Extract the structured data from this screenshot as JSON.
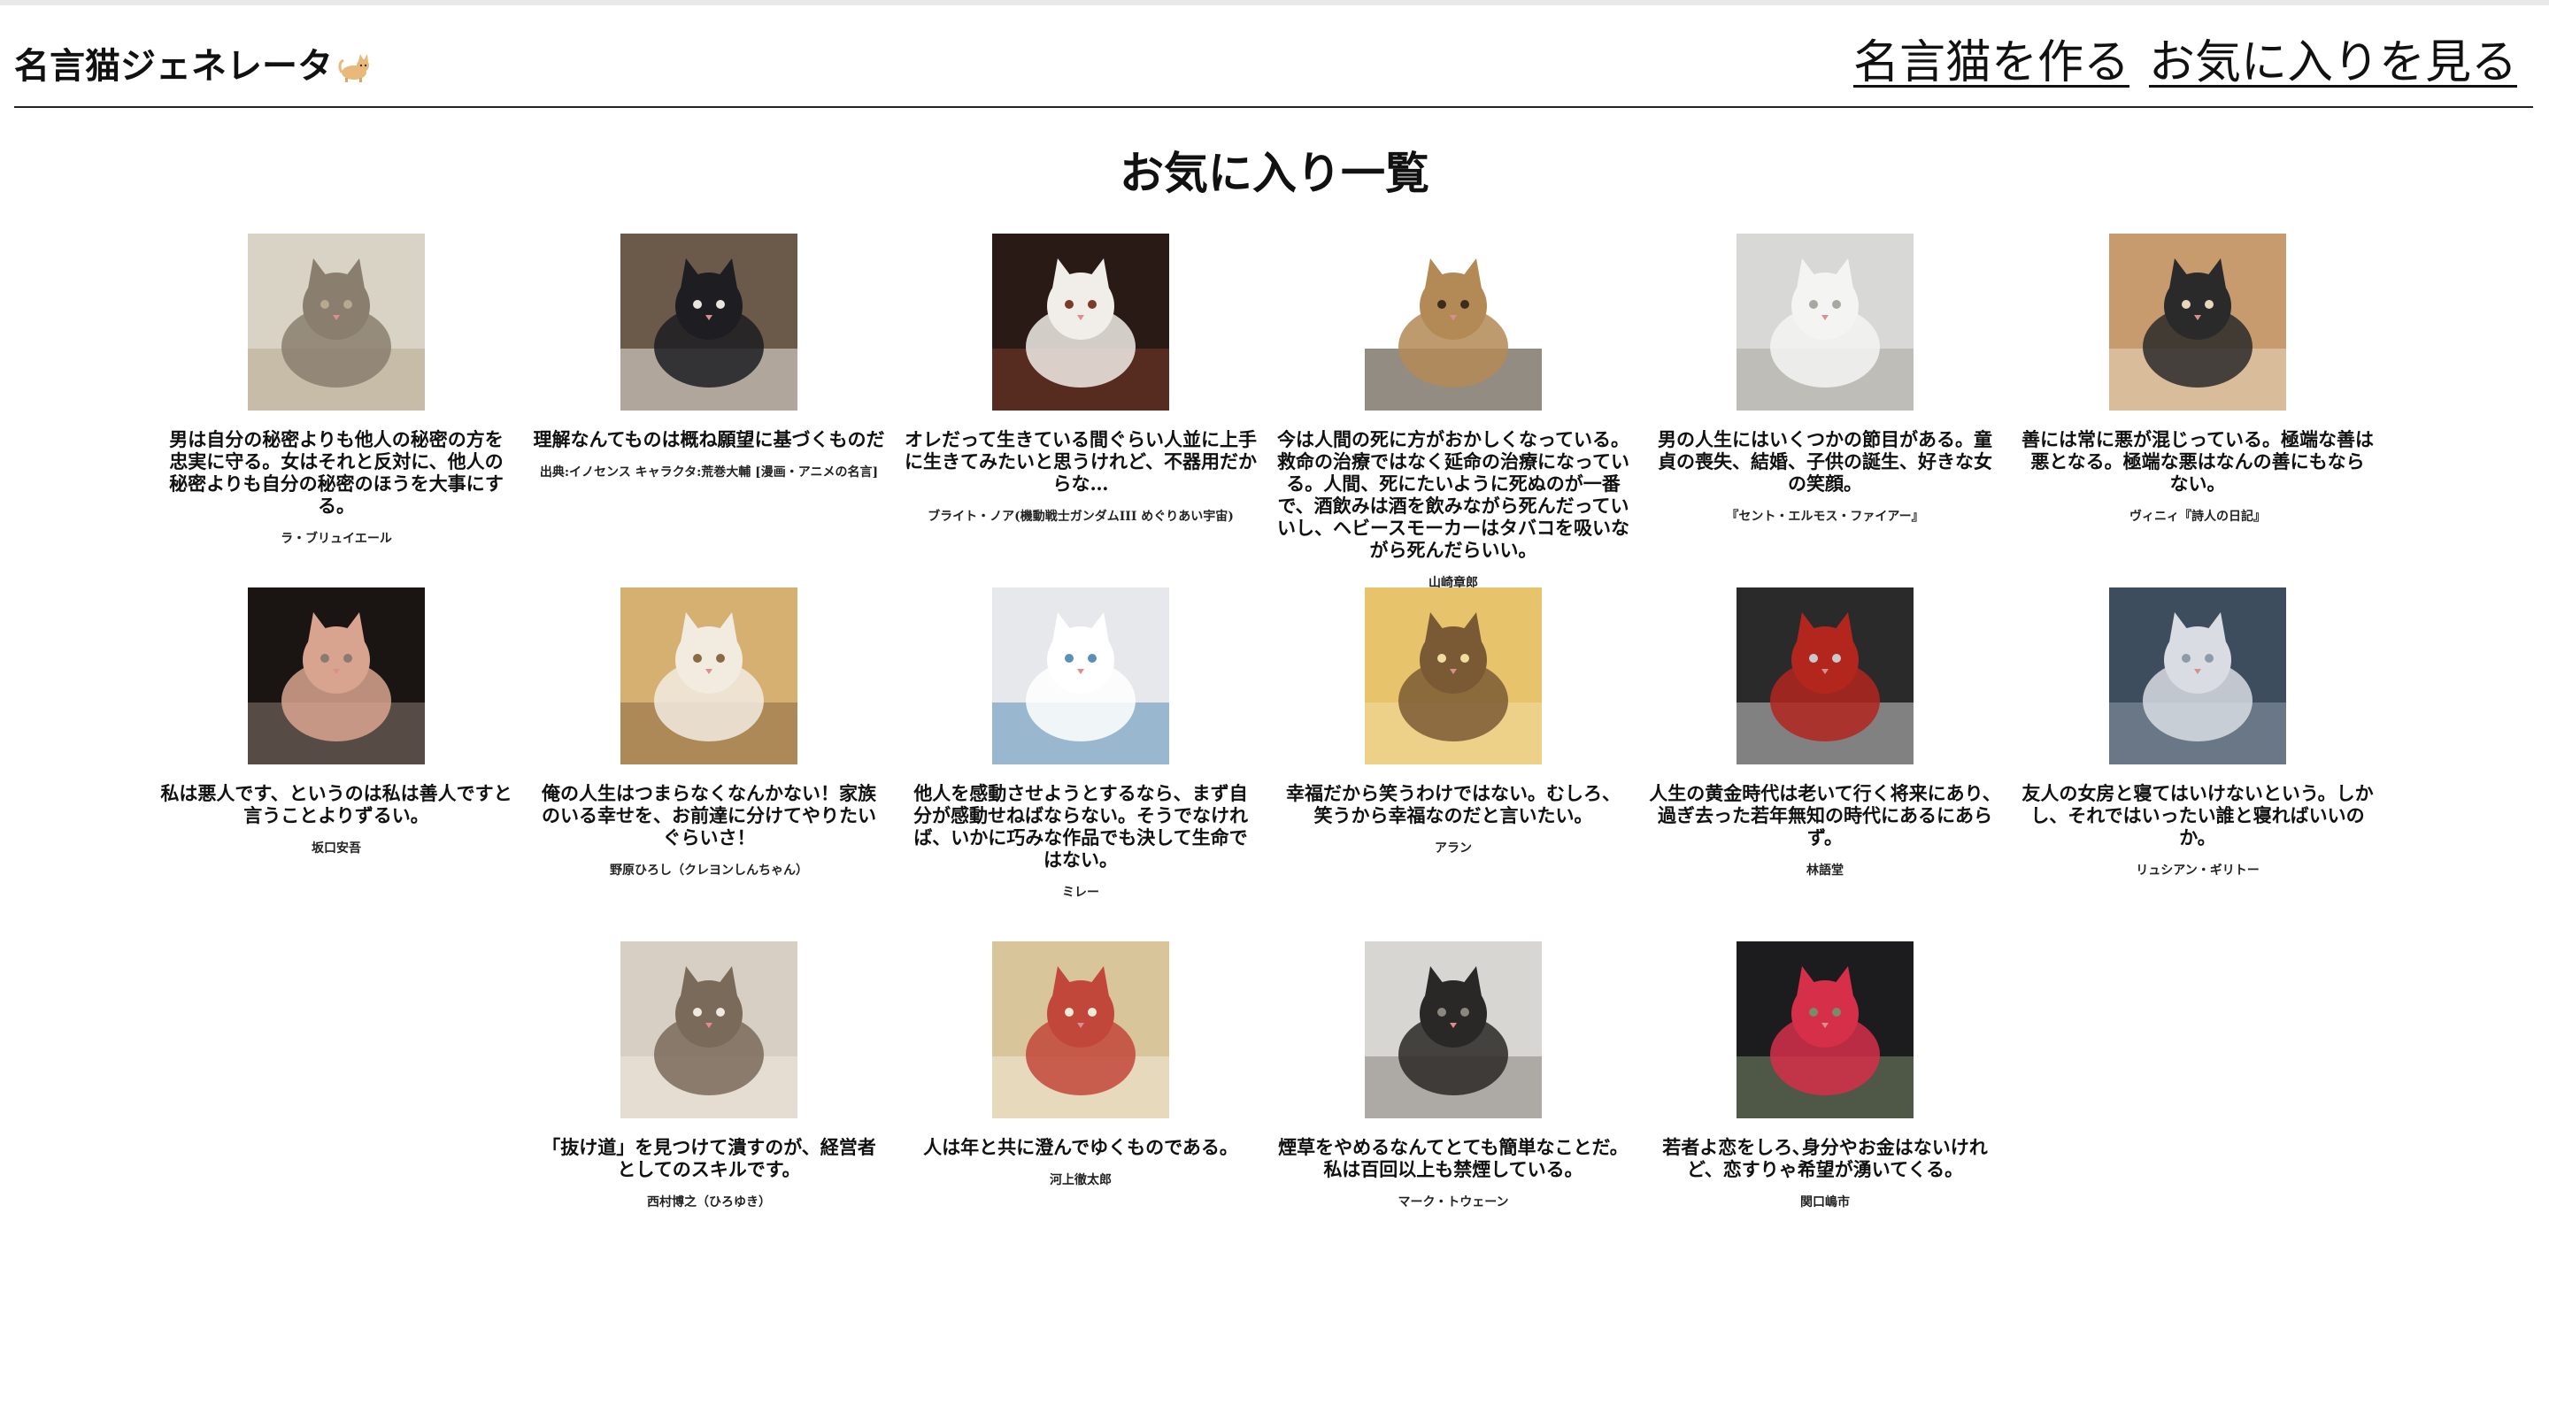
{
  "app": {
    "title": "名言猫ジェネレータ",
    "emoji_icon": "cat-emoji-icon"
  },
  "nav": {
    "create_label": "名言猫を作る",
    "favorites_label": "お気に入りを見る"
  },
  "page_title": "お気に入り一覧",
  "cards": [
    {
      "quote": "男は自分の秘密よりも他人の秘密の方を忠実に守る。女はそれと反対に、他人の秘密よりも自分の秘密のほうを大事にする。",
      "source": "ラ・ブリュイエール",
      "image": "kitten-crying",
      "colors": [
        "#d9d3c6",
        "#8a7f6e",
        "#b7a98f"
      ]
    },
    {
      "quote": "理解なんてものは概ね願望に基づくものだ",
      "source": "出典:イノセンス キャラクタ:荒巻大輔 [漫画・アニメの名言]",
      "image": "black-white-cat-stretching",
      "colors": [
        "#6b5a4a",
        "#1d1d22",
        "#e9e6e0"
      ]
    },
    {
      "quote": "オレだって生きている間ぐらい人並に上手に生きてみたいと思うけれど、不器用だからな…",
      "source": "ブライト・ノア(機動戦士ガンダムIII めぐりあい宇宙)",
      "image": "cat-on-back",
      "colors": [
        "#2a1a15",
        "#f1ede8",
        "#7a3b2a"
      ]
    },
    {
      "quote": "今は人間の死に方がおかしくなっている。救命の治療ではなく延命の治療になっている。人間、死にたいように死ぬのが一番で、酒飲みは酒を飲みながら死んだっていいし、ヘビースモーカーはタバコを吸いながら死んだらいい。",
      "source": "山崎章郎",
      "image": "bengal-cat",
      "colors": [
        "#ffffff",
        "#b38a56",
        "#3b2d1e"
      ]
    },
    {
      "quote": "男の人生にはいくつかの節目がある。童貞の喪失、結婚、子供の誕生、好きな女の笑顔。",
      "source": "『セント・エルモス・ファイアー』",
      "image": "white-cat-sleeping",
      "colors": [
        "#d8d8d6",
        "#f4f4f2",
        "#a9a7a1"
      ]
    },
    {
      "quote": "善には常に悪が混じっている。極端な善は悪となる。極端な悪はなんの善にもならない。",
      "source": "ヴィニィ『詩人の日記』",
      "image": "orange-cat-in-bed",
      "colors": [
        "#c79b6e",
        "#2a2a2a",
        "#e8d7bd"
      ]
    },
    {
      "quote": "私は悪人です、というのは私は善人ですと言うことよりずるい。",
      "source": "坂口安吾",
      "image": "kitten-in-hand",
      "colors": [
        "#1a1412",
        "#d9a48f",
        "#8b7a70"
      ]
    },
    {
      "quote": "俺の人生はつまらなくなんかない！家族のいる幸せを、お前達に分けてやりたいぐらいさ！",
      "source": "野原ひろし（クレヨンしんちゃん）",
      "image": "cat-face-closeup",
      "colors": [
        "#d6b071",
        "#f2ebe0",
        "#8a6a40"
      ]
    },
    {
      "quote": "他人を感動させようとするなら、まず自分が感動せねばならない。そうでなければ、いかに巧みな作品でも決して生命ではない。",
      "source": "ミレー",
      "image": "two-white-kittens",
      "colors": [
        "#e7e8ec",
        "#ffffff",
        "#5a8fb8"
      ]
    },
    {
      "quote": "幸福だから笑うわけではない。むしろ、笑うから幸福なのだと言いたい。",
      "source": "アラン",
      "image": "cat-on-yellow-floor",
      "colors": [
        "#e7c36b",
        "#7a5a34",
        "#f3dca0"
      ]
    },
    {
      "quote": "人生の黄金時代は老いて行く将来にあり、過ぎ去った若年無知の時代にあるにあらず。",
      "source": "林語堂",
      "image": "cat-in-red-sweater",
      "colors": [
        "#2a2a2a",
        "#b3261e",
        "#c9c9c9"
      ]
    },
    {
      "quote": "友人の女房と寝てはいけないという。しかし、それではいったい誰と寝ればいいのか。",
      "source": "リュシアン・ギリトー",
      "image": "fluffy-cat-by-window",
      "colors": [
        "#3d4d5e",
        "#d9dde3",
        "#8e9aa8"
      ]
    },
    {
      "quote": "「抜け道」を見つけて潰すのが、経営者としてのスキルです。",
      "source": "西村博之（ひろゆき）",
      "image": "tabby-kitten-held",
      "colors": [
        "#d8cfc4",
        "#7a6a5a",
        "#f1e8df"
      ]
    },
    {
      "quote": "人は年と共に澄んでゆくものである。",
      "source": "河上徹太郎",
      "image": "cat-in-bonnet",
      "colors": [
        "#d9c59a",
        "#c2473b",
        "#f3ead8"
      ]
    },
    {
      "quote": "煙草をやめるなんてとても簡単なことだ。私は百回以上も禁煙している。",
      "source": "マーク・トウェーン",
      "image": "kittens-playing-bw",
      "colors": [
        "#d8d6d2",
        "#2a2826",
        "#8a8680"
      ]
    },
    {
      "quote": "若者よ恋をしろ､身分やお金はないけれど、恋すりゃ希望が湧いてくる。",
      "source": "関口嶋市",
      "image": "black-cat-with-flower",
      "colors": [
        "#1c1c1e",
        "#d62f4a",
        "#7a8a6a"
      ]
    }
  ]
}
